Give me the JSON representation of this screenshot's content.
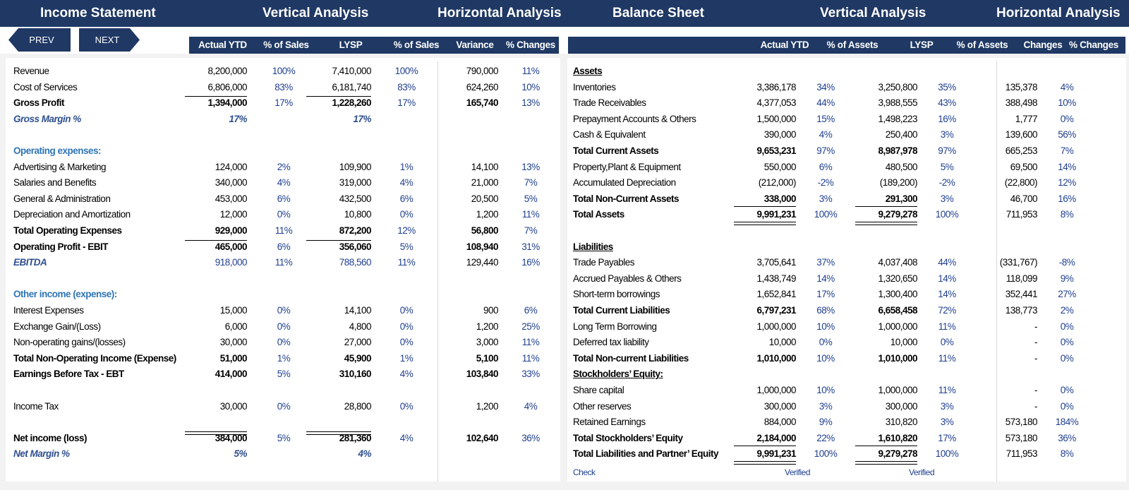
{
  "header": {
    "income_statement": "Income Statement",
    "vertical_analysis": "Vertical Analysis",
    "horizontal_analysis": "Horizontal Analysis",
    "balance_sheet": "Balance Sheet",
    "vertical_analysis_2": "Vertical Analysis",
    "horizontal_analysis_2": "Horizontal Analysis"
  },
  "nav": {
    "prev": "PREV",
    "next": "NEXT"
  },
  "is_columns": [
    "Actual YTD",
    "% of Sales",
    "LYSP",
    "% of Sales",
    "Variance",
    "% Changes"
  ],
  "bs_columns": [
    "Actual YTD",
    "% of Assets",
    "LYSP",
    "% of Assets",
    "Changes",
    "% Changes"
  ],
  "income_rows": [
    {
      "label": "Revenue",
      "a": "8,200,000",
      "ap": "100%",
      "l": "7,410,000",
      "lp": "100%",
      "v": "790,000",
      "vp": "11%",
      "style": ""
    },
    {
      "label": "Cost of Services",
      "a": "6,806,000",
      "ap": "83%",
      "l": "6,181,740",
      "lp": "83%",
      "v": "624,260",
      "vp": "10%",
      "style": ""
    },
    {
      "label": "Gross Profit",
      "a": "1,394,000",
      "ap": "17%",
      "l": "1,228,260",
      "lp": "17%",
      "v": "165,740",
      "vp": "13%",
      "style": "bold"
    },
    {
      "label": "Gross Margin %",
      "a": "17%",
      "ap": "",
      "l": "17%",
      "lp": "",
      "v": "",
      "vp": "",
      "style": "it"
    },
    {
      "label": "",
      "a": "",
      "ap": "",
      "l": "",
      "lp": "",
      "v": "",
      "vp": "",
      "style": ""
    },
    {
      "label": "Operating expenses:",
      "a": "",
      "ap": "",
      "l": "",
      "lp": "",
      "v": "",
      "vp": "",
      "style": "sec"
    },
    {
      "label": "Advertising & Marketing",
      "a": "124,000",
      "ap": "2%",
      "l": "109,900",
      "lp": "1%",
      "v": "14,100",
      "vp": "13%",
      "style": ""
    },
    {
      "label": "Salaries and Benefits",
      "a": "340,000",
      "ap": "4%",
      "l": "319,000",
      "lp": "4%",
      "v": "21,000",
      "vp": "7%",
      "style": ""
    },
    {
      "label": "General & Administration",
      "a": "453,000",
      "ap": "6%",
      "l": "432,500",
      "lp": "6%",
      "v": "20,500",
      "vp": "5%",
      "style": ""
    },
    {
      "label": "Depreciation and Amortization",
      "a": "12,000",
      "ap": "0%",
      "l": "10,800",
      "lp": "0%",
      "v": "1,200",
      "vp": "11%",
      "style": ""
    },
    {
      "label": "Total Operating Expenses",
      "a": "929,000",
      "ap": "11%",
      "l": "872,200",
      "lp": "12%",
      "v": "56,800",
      "vp": "7%",
      "style": "bold"
    },
    {
      "label": "Operating Profit - EBIT",
      "a": "465,000",
      "ap": "6%",
      "l": "356,060",
      "lp": "5%",
      "v": "108,940",
      "vp": "31%",
      "style": "bold"
    },
    {
      "label": "EBITDA",
      "a": "918,000",
      "ap": "11%",
      "l": "788,560",
      "lp": "11%",
      "v": "129,440",
      "vp": "16%",
      "style": "ebitda"
    },
    {
      "label": "",
      "a": "",
      "ap": "",
      "l": "",
      "lp": "",
      "v": "",
      "vp": "",
      "style": ""
    },
    {
      "label": "Other income (expense):",
      "a": "",
      "ap": "",
      "l": "",
      "lp": "",
      "v": "",
      "vp": "",
      "style": "sec"
    },
    {
      "label": "Interest Expenses",
      "a": "15,000",
      "ap": "0%",
      "l": "14,100",
      "lp": "0%",
      "v": "900",
      "vp": "6%",
      "style": ""
    },
    {
      "label": "Exchange Gain/(Loss)",
      "a": "6,000",
      "ap": "0%",
      "l": "4,800",
      "lp": "0%",
      "v": "1,200",
      "vp": "25%",
      "style": ""
    },
    {
      "label": "Non-operating gains/(losses)",
      "a": "30,000",
      "ap": "0%",
      "l": "27,000",
      "lp": "0%",
      "v": "3,000",
      "vp": "11%",
      "style": ""
    },
    {
      "label": "Total Non-Operating Income (Expense)",
      "a": "51,000",
      "ap": "1%",
      "l": "45,900",
      "lp": "1%",
      "v": "5,100",
      "vp": "11%",
      "style": "bold"
    },
    {
      "label": "Earnings Before Tax - EBT",
      "a": "414,000",
      "ap": "5%",
      "l": "310,160",
      "lp": "4%",
      "v": "103,840",
      "vp": "33%",
      "style": "bold"
    },
    {
      "label": "",
      "a": "",
      "ap": "",
      "l": "",
      "lp": "",
      "v": "",
      "vp": "",
      "style": ""
    },
    {
      "label": "Income Tax",
      "a": "30,000",
      "ap": "0%",
      "l": "28,800",
      "lp": "0%",
      "v": "1,200",
      "vp": "4%",
      "style": ""
    },
    {
      "label": "",
      "a": "",
      "ap": "",
      "l": "",
      "lp": "",
      "v": "",
      "vp": "",
      "style": ""
    },
    {
      "label": "Net income (loss)",
      "a": "384,000",
      "ap": "5%",
      "l": "281,360",
      "lp": "4%",
      "v": "102,640",
      "vp": "36%",
      "style": "bold"
    },
    {
      "label": "Net Margin %",
      "a": "5%",
      "ap": "",
      "l": "4%",
      "lp": "",
      "v": "",
      "vp": "",
      "style": "it"
    }
  ],
  "balance_rows": [
    {
      "label": "Assets",
      "a": "",
      "ap": "",
      "l": "",
      "lp": "",
      "v": "",
      "vp": "",
      "style": "ul"
    },
    {
      "label": "Inventories",
      "a": "3,386,178",
      "ap": "34%",
      "l": "3,250,800",
      "lp": "35%",
      "v": "135,378",
      "vp": "4%",
      "style": ""
    },
    {
      "label": "Trade Receivables",
      "a": "4,377,053",
      "ap": "44%",
      "l": "3,988,555",
      "lp": "43%",
      "v": "388,498",
      "vp": "10%",
      "style": ""
    },
    {
      "label": "Prepayment Accounts & Others",
      "a": "1,500,000",
      "ap": "15%",
      "l": "1,498,223",
      "lp": "16%",
      "v": "1,777",
      "vp": "0%",
      "style": ""
    },
    {
      "label": "Cash  & Equivalent",
      "a": "390,000",
      "ap": "4%",
      "l": "250,400",
      "lp": "3%",
      "v": "139,600",
      "vp": "56%",
      "style": ""
    },
    {
      "label": "Total Current Assets",
      "a": "9,653,231",
      "ap": "97%",
      "l": "8,987,978",
      "lp": "97%",
      "v": "665,253",
      "vp": "7%",
      "style": "bold"
    },
    {
      "label": "Property,Plant & Equipment",
      "a": "550,000",
      "ap": "6%",
      "l": "480,500",
      "lp": "5%",
      "v": "69,500",
      "vp": "14%",
      "style": ""
    },
    {
      "label": "Accumulated Depreciation",
      "a": "(212,000)",
      "ap": "-2%",
      "l": "(189,200)",
      "lp": "-2%",
      "v": "(22,800)",
      "vp": "12%",
      "style": ""
    },
    {
      "label": "Total Non-Current Assets",
      "a": "338,000",
      "ap": "3%",
      "l": "291,300",
      "lp": "3%",
      "v": "46,700",
      "vp": "16%",
      "style": "bold"
    },
    {
      "label": "Total Assets",
      "a": "9,991,231",
      "ap": "100%",
      "l": "9,279,278",
      "lp": "100%",
      "v": "711,953",
      "vp": "8%",
      "style": "bold"
    },
    {
      "label": "",
      "a": "",
      "ap": "",
      "l": "",
      "lp": "",
      "v": "",
      "vp": "",
      "style": ""
    },
    {
      "label": "Liabilities",
      "a": "",
      "ap": "",
      "l": "",
      "lp": "",
      "v": "",
      "vp": "",
      "style": "ul"
    },
    {
      "label": "Trade Payables",
      "a": "3,705,641",
      "ap": "37%",
      "l": "4,037,408",
      "lp": "44%",
      "v": "(331,767)",
      "vp": "-8%",
      "style": ""
    },
    {
      "label": "Accrued Payables & Others",
      "a": "1,438,749",
      "ap": "14%",
      "l": "1,320,650",
      "lp": "14%",
      "v": "118,099",
      "vp": "9%",
      "style": ""
    },
    {
      "label": "Short-term borrowings",
      "a": "1,652,841",
      "ap": "17%",
      "l": "1,300,400",
      "lp": "14%",
      "v": "352,441",
      "vp": "27%",
      "style": ""
    },
    {
      "label": "Total Current Liabilities",
      "a": "6,797,231",
      "ap": "68%",
      "l": "6,658,458",
      "lp": "72%",
      "v": "138,773",
      "vp": "2%",
      "style": "bold"
    },
    {
      "label": "Long Term Borrowing",
      "a": "1,000,000",
      "ap": "10%",
      "l": "1,000,000",
      "lp": "11%",
      "v": "-",
      "vp": "0%",
      "style": ""
    },
    {
      "label": "Deferred tax liability",
      "a": "10,000",
      "ap": "0%",
      "l": "10,000",
      "lp": "0%",
      "v": "-",
      "vp": "0%",
      "style": ""
    },
    {
      "label": "Total Non-current Liabilities",
      "a": "1,010,000",
      "ap": "10%",
      "l": "1,010,000",
      "lp": "11%",
      "v": "-",
      "vp": "0%",
      "style": "bold"
    },
    {
      "label": "Stockholders’ Equity:",
      "a": "",
      "ap": "",
      "l": "",
      "lp": "",
      "v": "",
      "vp": "",
      "style": "ul"
    },
    {
      "label": "Share capital",
      "a": "1,000,000",
      "ap": "10%",
      "l": "1,000,000",
      "lp": "11%",
      "v": "-",
      "vp": "0%",
      "style": ""
    },
    {
      "label": "Other reserves",
      "a": "300,000",
      "ap": "3%",
      "l": "300,000",
      "lp": "3%",
      "v": "-",
      "vp": "0%",
      "style": ""
    },
    {
      "label": "Retained Earnings",
      "a": "884,000",
      "ap": "9%",
      "l": "310,820",
      "lp": "3%",
      "v": "573,180",
      "vp": "184%",
      "style": ""
    },
    {
      "label": "Total Stockholders’ Equity",
      "a": "2,184,000",
      "ap": "22%",
      "l": "1,610,820",
      "lp": "17%",
      "v": "573,180",
      "vp": "36%",
      "style": "bold"
    },
    {
      "label": "Total Liabilities and Partner’ Equity",
      "a": "9,991,231",
      "ap": "100%",
      "l": "9,279,278",
      "lp": "100%",
      "v": "711,953",
      "vp": "8%",
      "style": "bold"
    }
  ],
  "check": {
    "label": "Check",
    "a": "Verified",
    "l": "Verified"
  }
}
